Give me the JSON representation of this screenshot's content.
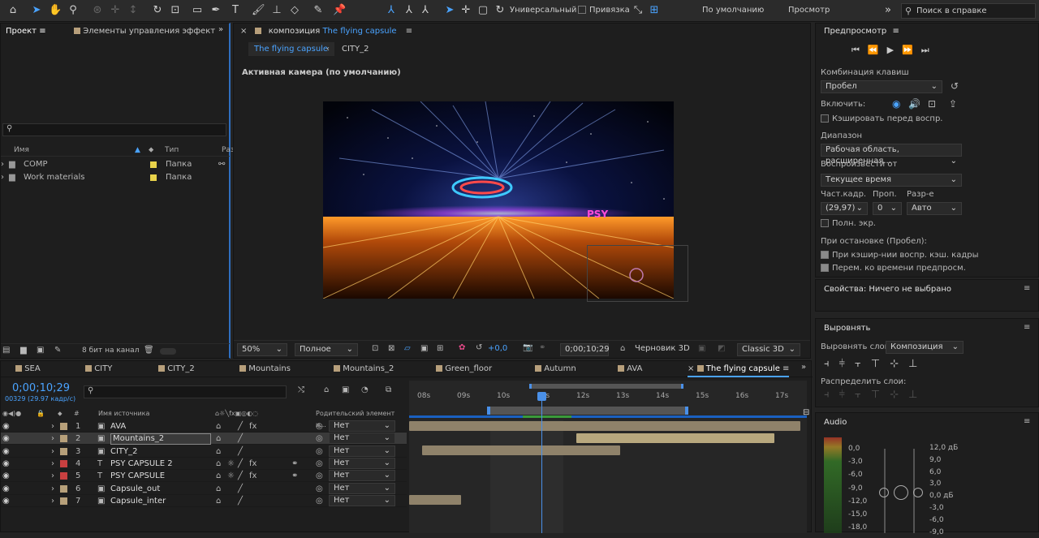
{
  "toolbar": {
    "workspace_mode": "Универсальный",
    "snap_label": "Привязка",
    "default_workspace": "По умолчанию",
    "review": "Просмотр",
    "search_placeholder": "Поиск в справке"
  },
  "project": {
    "tab": "Проект",
    "effects_tab": "Элементы управления эффект",
    "search_placeholder": "",
    "col_name": "Имя",
    "col_type": "Тип",
    "col_size": "Раз",
    "items": [
      {
        "name": "COMP",
        "type": "Папка"
      },
      {
        "name": "Work materials",
        "type": "Папка"
      }
    ],
    "bit_depth": "8 бит на канал"
  },
  "composition": {
    "tab_prefix": "композиция",
    "tab_name": "The flying capsule",
    "breadcrumb_1": "The flying capsule",
    "breadcrumb_2": "CITY_2",
    "camera_label": "Активная камера (по умолчанию)",
    "overlay_text": "PSY",
    "zoom": "50%",
    "resolution": "Полное",
    "exposure": "+0,0",
    "timecode": "0;00;10;29",
    "renderer_draft": "Черновик 3D",
    "renderer": "Classic 3D"
  },
  "preview": {
    "title": "Предпросмотр",
    "shortcut_label": "Комбинация клавиш",
    "shortcut_value": "Пробел",
    "include_label": "Включить:",
    "cache_label": "Кэшировать перед воспр.",
    "cache_checked": false,
    "range_label": "Диапазон",
    "range_value": "Рабочая область, расширенная...",
    "play_from_label": "Воспроизвести от",
    "play_from_value": "Текущее время",
    "fps_label": "Част.кадр.",
    "skip_label": "Проп.",
    "res_label": "Разр-е",
    "fps_value": "(29,97)",
    "skip_value": "0",
    "res_value": "Авто",
    "fullscreen_label": "Полн. экр.",
    "fullscreen_checked": false,
    "on_stop_label": "При остановке (Пробел):",
    "on_stop_opt1": "При кэшир-нии воспр. кэш. кадры",
    "on_stop_opt1_checked": true,
    "on_stop_opt2": "Перем. ко времени предпросм.",
    "on_stop_opt2_checked": true
  },
  "properties": {
    "title": "Свойства: Ничего не выбрано"
  },
  "align": {
    "title": "Выровнять",
    "align_to_label": "Выровнять слои:",
    "align_to_value": "Композиция",
    "distribute_label": "Распределить слои:"
  },
  "audio": {
    "title": "Audio",
    "left_scale": [
      "0,0",
      "-3,0",
      "-6,0",
      "-9,0",
      "-12,0",
      "-15,0",
      "-18,0"
    ],
    "right_scale": [
      "12,0 дБ",
      "9,0",
      "6,0",
      "3,0",
      "0,0 дБ",
      "-3,0",
      "-6,0",
      "-9,0"
    ]
  },
  "timeline": {
    "tabs": [
      "SEA",
      "CITY",
      "CITY_2",
      "Mountains",
      "Mountains_2",
      "Green_floor",
      "Autumn",
      "AVA",
      "The flying capsule"
    ],
    "timecode": "0;00;10;29",
    "frame_info": "00329 (29.97 кадр/с)",
    "col_hash": "#",
    "col_source": "Имя источника",
    "col_parent": "Родительский элемент и...",
    "parent_none": "Нет",
    "ruler": [
      "08s",
      "09s",
      "10s",
      "11s",
      "12s",
      "13s",
      "14s",
      "15s",
      "16s",
      "17s"
    ],
    "ruler_playhead": "11s",
    "layers": [
      {
        "num": "1",
        "name": "AVA",
        "label_color": "#b7a07a"
      },
      {
        "num": "2",
        "name": "Mountains_2",
        "label_color": "#b7a07a"
      },
      {
        "num": "3",
        "name": "CITY_2",
        "label_color": "#b7a07a"
      },
      {
        "num": "4",
        "name": "PSY CAPSULE 2",
        "label_color": "#c94040"
      },
      {
        "num": "5",
        "name": "PSY CAPSULE",
        "label_color": "#c94040"
      },
      {
        "num": "6",
        "name": "Capsule_out",
        "label_color": "#b7a07a"
      },
      {
        "num": "7",
        "name": "Capsule_inter",
        "label_color": "#b7a07a"
      }
    ]
  }
}
